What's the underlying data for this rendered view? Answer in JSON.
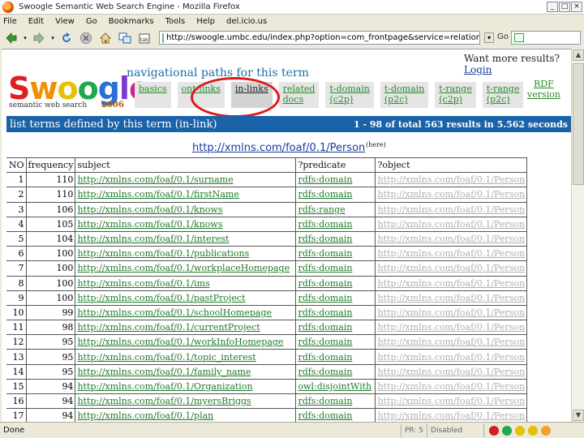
{
  "window": {
    "title": "Swoogle Semantic Web Search Engine - Mozilla Firefox",
    "buttons": [
      "_",
      "□",
      "×"
    ]
  },
  "menubar": [
    "File",
    "Edit",
    "View",
    "Go",
    "Bookmarks",
    "Tools",
    "Help",
    "del.icio.us"
  ],
  "navbar": {
    "url": "http://swoogle.umbc.edu/index.php?option=com_frontpage&service=relation&queryType=rel_swd_swt&searchString=",
    "go_label": "Go"
  },
  "page": {
    "logo": {
      "brand_letters": [
        "S",
        "w",
        "o",
        "o",
        "g",
        "l",
        "e"
      ],
      "tagline": "semantic web search",
      "year": "2006"
    },
    "nav_title": "navigational paths for this  term",
    "want_more": "Want more results?",
    "login": "Login",
    "tabs": [
      {
        "line1": "basics",
        "line2": "",
        "active": false
      },
      {
        "line1": "ont-links",
        "line2": "",
        "active": false
      },
      {
        "line1": "in-links",
        "line2": "",
        "active": true
      },
      {
        "line1": "related",
        "line2": "docs",
        "active": false
      },
      {
        "line1": "t-domain",
        "line2": "(c2p)",
        "active": false
      },
      {
        "line1": "t-domain",
        "line2": "(p2c)",
        "active": false
      },
      {
        "line1": "t-range",
        "line2": "(c2p)",
        "active": false
      },
      {
        "line1": "t-range",
        "line2": "(p2c)",
        "active": false
      }
    ],
    "rdf_version": {
      "line1": "RDF",
      "line2": "version"
    },
    "bar_left": "list terms defined by this term (in-link)",
    "bar_right": "1 - 98 of total 563 results in 5.562 seconds",
    "object_uri": "http://xmlns.com/foaf/0.1/Person",
    "object_tag": "(here)",
    "table": {
      "headers": [
        "NO",
        "frequency",
        "subject",
        "?predicate",
        "?object"
      ],
      "rows": [
        {
          "no": "1",
          "freq": "110",
          "subject": "http://xmlns.com/foaf/0.1/surname",
          "predicate": "rdfs:domain",
          "object": "http://xmlns.com/foaf/0.1/Person"
        },
        {
          "no": "2",
          "freq": "110",
          "subject": "http://xmlns.com/foaf/0.1/firstName",
          "predicate": "rdfs:domain",
          "object": "http://xmlns.com/foaf/0.1/Person"
        },
        {
          "no": "3",
          "freq": "106",
          "subject": "http://xmlns.com/foaf/0.1/knows",
          "predicate": "rdfs:range",
          "object": "http://xmlns.com/foaf/0.1/Person"
        },
        {
          "no": "4",
          "freq": "105",
          "subject": "http://xmlns.com/foaf/0.1/knows",
          "predicate": "rdfs:domain",
          "object": "http://xmlns.com/foaf/0.1/Person"
        },
        {
          "no": "5",
          "freq": "104",
          "subject": "http://xmlns.com/foaf/0.1/interest",
          "predicate": "rdfs:domain",
          "object": "http://xmlns.com/foaf/0.1/Person"
        },
        {
          "no": "6",
          "freq": "100",
          "subject": "http://xmlns.com/foaf/0.1/publications",
          "predicate": "rdfs:domain",
          "object": "http://xmlns.com/foaf/0.1/Person"
        },
        {
          "no": "7",
          "freq": "100",
          "subject": "http://xmlns.com/foaf/0.1/workplaceHomepage",
          "predicate": "rdfs:domain",
          "object": "http://xmlns.com/foaf/0.1/Person"
        },
        {
          "no": "8",
          "freq": "100",
          "subject": "http://xmlns.com/foaf/0.1/ims",
          "predicate": "rdfs:domain",
          "object": "http://xmlns.com/foaf/0.1/Person"
        },
        {
          "no": "9",
          "freq": "100",
          "subject": "http://xmlns.com/foaf/0.1/pastProject",
          "predicate": "rdfs:domain",
          "object": "http://xmlns.com/foaf/0.1/Person"
        },
        {
          "no": "10",
          "freq": "99",
          "subject": "http://xmlns.com/foaf/0.1/schoolHomepage",
          "predicate": "rdfs:domain",
          "object": "http://xmlns.com/foaf/0.1/Person"
        },
        {
          "no": "11",
          "freq": "98",
          "subject": "http://xmlns.com/foaf/0.1/currentProject",
          "predicate": "rdfs:domain",
          "object": "http://xmlns.com/foaf/0.1/Person"
        },
        {
          "no": "12",
          "freq": "95",
          "subject": "http://xmlns.com/foaf/0.1/workInfoHomepage",
          "predicate": "rdfs:domain",
          "object": "http://xmlns.com/foaf/0.1/Person"
        },
        {
          "no": "13",
          "freq": "95",
          "subject": "http://xmlns.com/foaf/0.1/topic_interest",
          "predicate": "rdfs:domain",
          "object": "http://xmlns.com/foaf/0.1/Person"
        },
        {
          "no": "14",
          "freq": "95",
          "subject": "http://xmlns.com/foaf/0.1/family_name",
          "predicate": "rdfs:domain",
          "object": "http://xmlns.com/foaf/0.1/Person"
        },
        {
          "no": "15",
          "freq": "94",
          "subject": "http://xmlns.com/foaf/0.1/Organization",
          "predicate": "owl:disjointWith",
          "object": "http://xmlns.com/foaf/0.1/Person"
        },
        {
          "no": "16",
          "freq": "94",
          "subject": "http://xmlns.com/foaf/0.1/myersBriggs",
          "predicate": "rdfs:domain",
          "object": "http://xmlns.com/foaf/0.1/Person"
        },
        {
          "no": "17",
          "freq": "94",
          "subject": "http://xmlns.com/foaf/0.1/plan",
          "predicate": "rdfs:domain",
          "object": "http://xmlns.com/foaf/0.1/Person"
        }
      ]
    }
  },
  "statusbar": {
    "status": "Done",
    "seg1": "PR: 5",
    "seg2": "Disabled"
  },
  "colors": {
    "link_green": "#1f7a2a",
    "bar_blue": "#1b63a8",
    "highlight_red": "#e01818",
    "object_gray": "#b0b0b0"
  }
}
